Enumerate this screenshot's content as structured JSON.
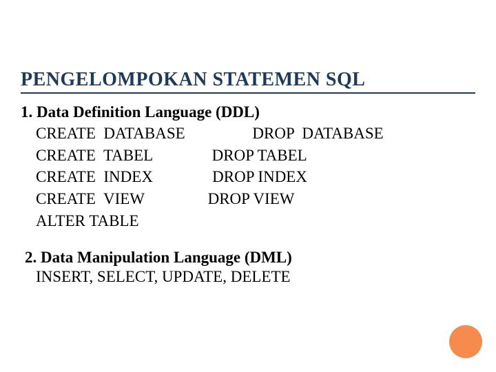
{
  "title": "PENGELOMPOKAN STATEMEN SQL",
  "ddl": {
    "heading": "1. Data Definition Language (DDL)",
    "rows": [
      "CREATE  DATABASE                 DROP  DATABASE",
      "CREATE  TABEL               DROP TABEL",
      "CREATE  INDEX               DROP INDEX",
      "CREATE  VIEW                DROP VIEW",
      "ALTER TABLE"
    ]
  },
  "dml": {
    "heading": "2. Data Manipulation Language (DML)",
    "items": "INSERT, SELECT, UPDATE, DELETE"
  }
}
